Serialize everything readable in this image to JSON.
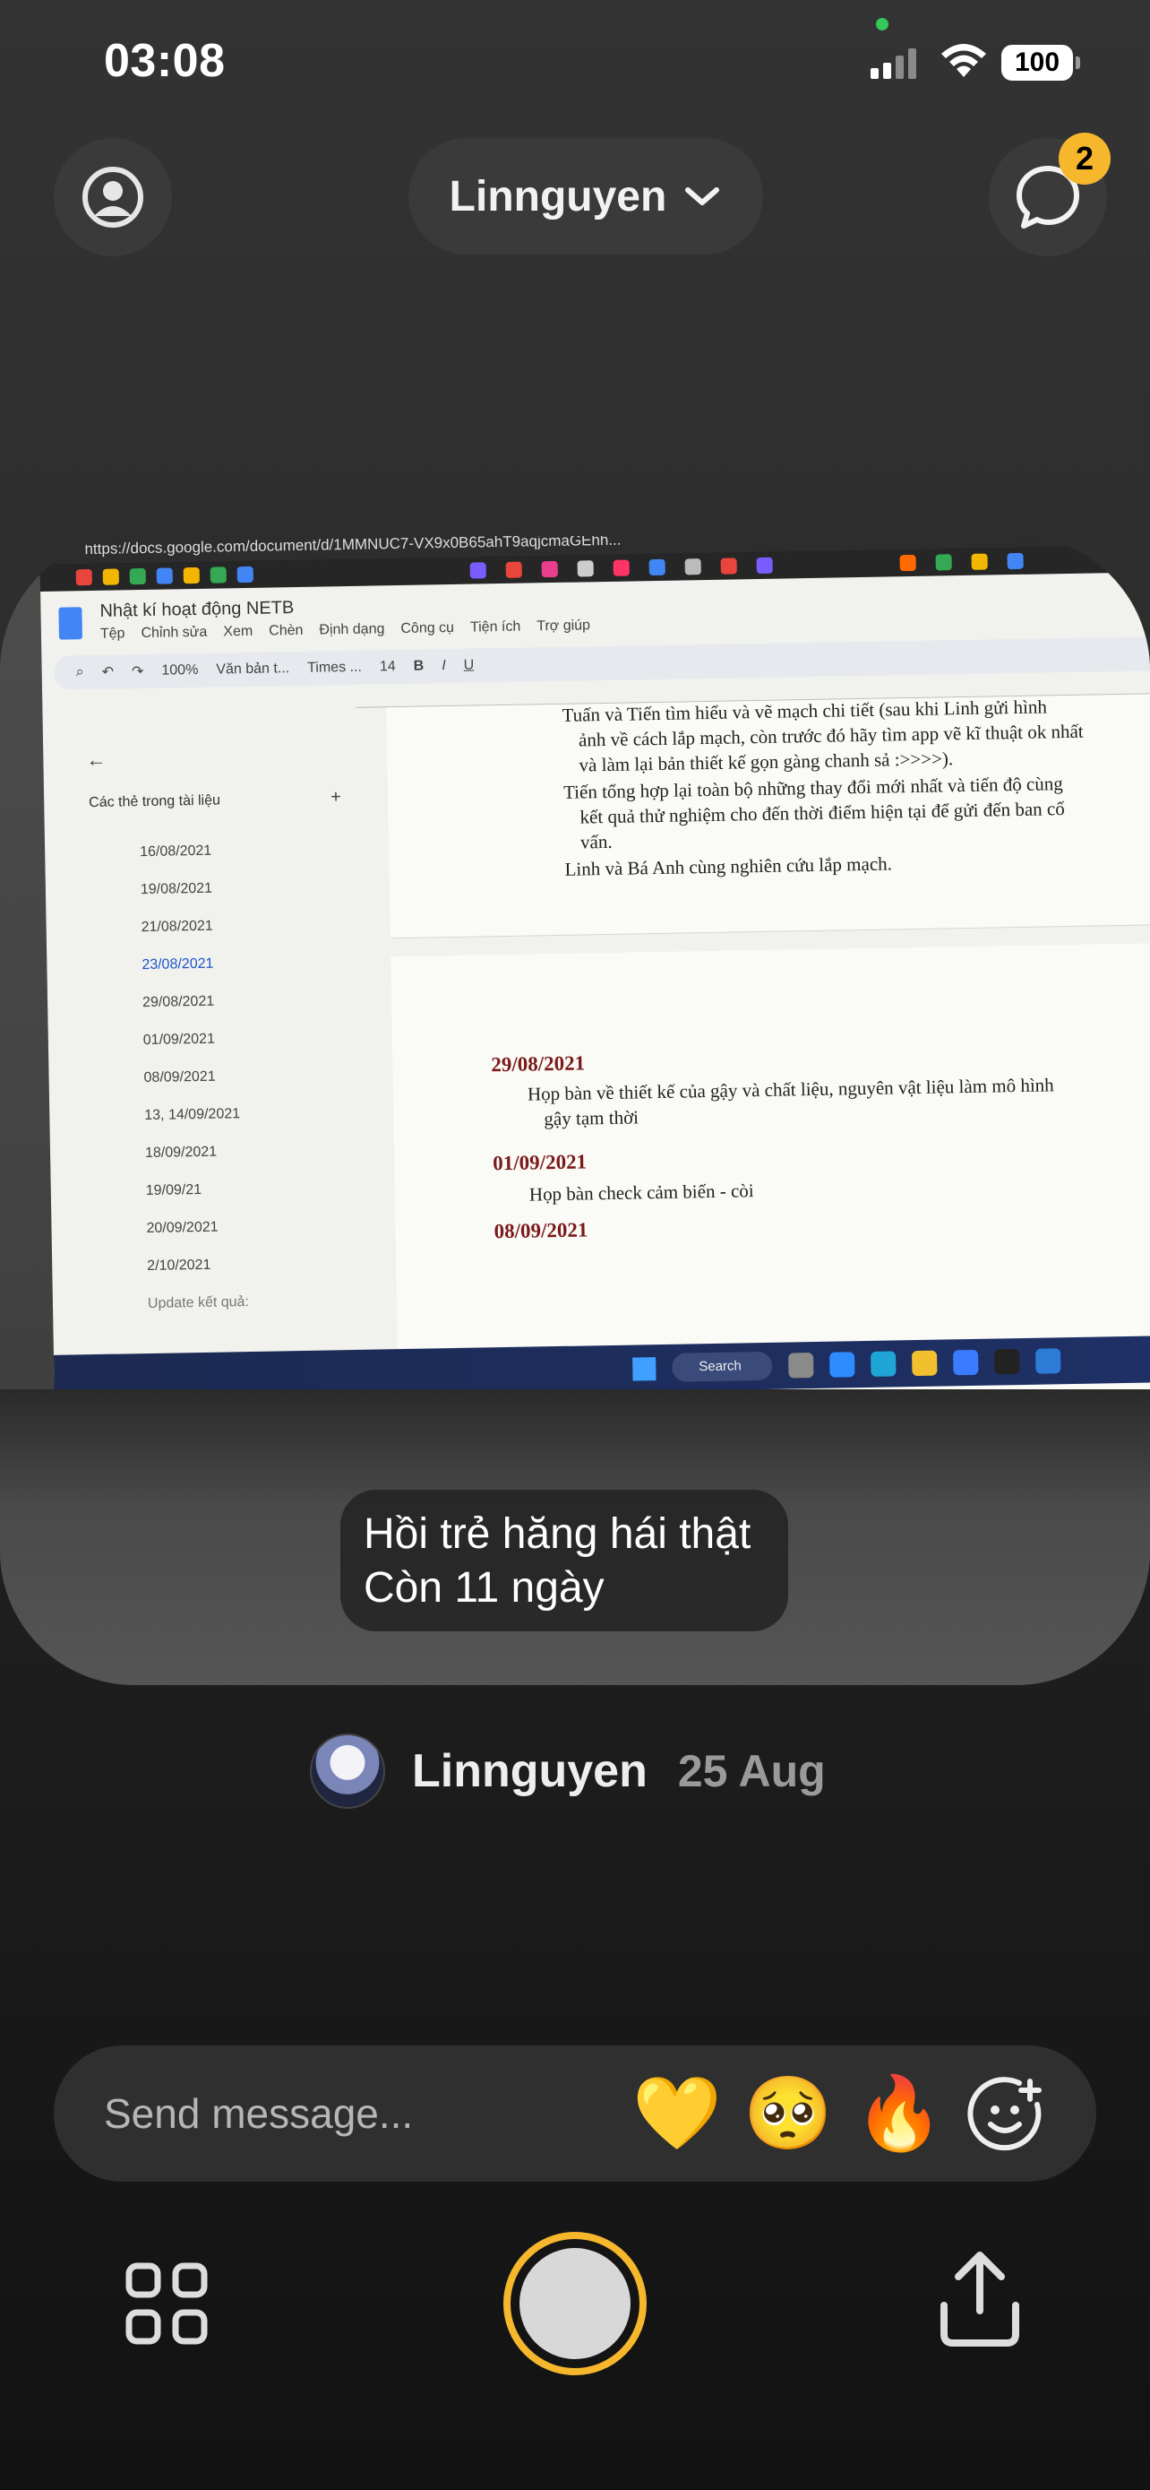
{
  "status_bar": {
    "time": "03:08",
    "battery": "100"
  },
  "header": {
    "username": "Linnguyen",
    "chat_badge_count": "2"
  },
  "photo": {
    "browser_url": "https://docs.google.com/document/d/1MMNUC7-VX9x0B65ahT9aqjcmaGEhh...",
    "doc_title": "Nhật kí hoạt động NETB",
    "doc_menu": [
      "Tệp",
      "Chỉnh sửa",
      "Xem",
      "Chèn",
      "Định dạng",
      "Công cụ",
      "Tiện ích",
      "Trợ giúp"
    ],
    "toolbar": {
      "zoom": "100%",
      "style": "Văn bản t...",
      "font": "Times ...",
      "size": "14"
    },
    "outline_title": "Các thẻ trong tài liệu",
    "outline_items": [
      "16/08/2021",
      "19/08/2021",
      "21/08/2021",
      "23/08/2021",
      "29/08/2021",
      "01/09/2021",
      "08/09/2021",
      "13, 14/09/2021",
      "18/09/2021",
      "19/09/21",
      "20/09/2021",
      "2/10/2021",
      "Update kết quả:"
    ],
    "page1_lines": [
      "Tuấn và Tiến tìm hiểu và vẽ mạch chi tiết (sau khi Linh gửi hình",
      "ảnh về cách lắp mạch, còn trước đó hãy tìm app vẽ kĩ thuật ok nhất",
      "và làm lại bản thiết kế gọn gàng chanh sả :>>>>).",
      "Tiến tổng hợp lại toàn bộ những thay đổi mới nhất và tiến độ cùng",
      "kết quả thử nghiệm cho đến thời điểm hiện tại để gửi đến ban cố",
      "vấn.",
      "Linh và Bá Anh cùng nghiên cứu lắp mạch."
    ],
    "entry1_date": "29/08/2021",
    "entry1_lines": [
      "Họp bàn về thiết kế của gậy và chất liệu, nguyên vật liệu làm mô hình",
      "gậy tạm thời"
    ],
    "entry2_date": "01/09/2021",
    "entry2_lines": [
      "Họp bàn check cảm biến - còi"
    ],
    "entry3_date": "08/09/2021",
    "taskbar_search": "Search"
  },
  "caption": {
    "line1": "Hồi trẻ hăng hái thật",
    "line2": "Còn 11 ngày"
  },
  "post": {
    "author": "Linnguyen",
    "date": "25 Aug"
  },
  "message": {
    "placeholder": "Send message..."
  },
  "reactions": [
    "💛",
    "🥺",
    "🔥"
  ],
  "colors": {
    "accent": "#f6b72d",
    "background": "#2b2b2b",
    "pill": "#3a3a3a"
  }
}
